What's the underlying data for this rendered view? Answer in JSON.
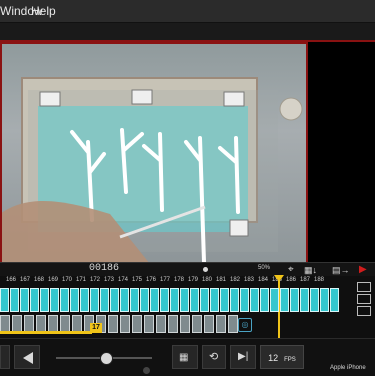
{
  "menu": {
    "items": [
      {
        "label": "Window"
      },
      {
        "label": "Help"
      }
    ]
  },
  "toolbar": {
    "frame_counter": "00186",
    "zoom_percent": "50%"
  },
  "timeline": {
    "frame_numbers": [
      "166",
      "167",
      "168",
      "169",
      "170",
      "171",
      "172",
      "173",
      "174",
      "175",
      "176",
      "177",
      "178",
      "179",
      "180",
      "181",
      "182",
      "183",
      "184",
      "185",
      "186",
      "187",
      "188"
    ],
    "current_frame": 186,
    "highlight_badge": "17"
  },
  "transport": {
    "fps": "12",
    "fps_unit": "FPS",
    "device_label": "Apple iPhone"
  },
  "colors": {
    "accent_red": "#8a1212",
    "cyan": "#35c7cf",
    "playhead": "#f0c419"
  },
  "icons": {
    "play_prev": "step-backward-icon",
    "play_back": "play-backward-icon",
    "play": "play-icon",
    "loop": "loop-icon",
    "play_next": "step-forward-icon",
    "frame_grid": "frame-grid-icon",
    "camera": "camera-icon"
  }
}
